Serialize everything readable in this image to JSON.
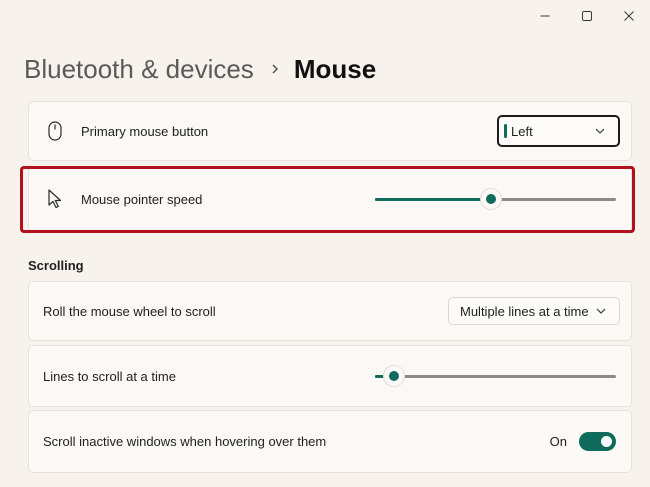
{
  "window": {
    "controls": [
      "minimize",
      "maximize",
      "close"
    ]
  },
  "header": {
    "parent": "Bluetooth & devices",
    "current": "Mouse"
  },
  "settings": {
    "primary_button": {
      "label": "Primary mouse button",
      "value": "Left",
      "icon": "mouse-icon"
    },
    "pointer_speed": {
      "label": "Mouse pointer speed",
      "icon": "pointer-icon",
      "level": 0.48,
      "highlighted": true
    }
  },
  "scrolling": {
    "section_title": "Scrolling",
    "roll_wheel": {
      "label": "Roll the mouse wheel to scroll",
      "value": "Multiple lines at a time"
    },
    "lines_to_scroll": {
      "label": "Lines to scroll at a time",
      "level": 0.08
    },
    "inactive_windows": {
      "label": "Scroll inactive windows when hovering over them",
      "state_text": "On",
      "on": true
    }
  },
  "colors": {
    "accent": "#0f6b5c",
    "highlight": "#b1101c",
    "background": "#f7f2ec"
  }
}
